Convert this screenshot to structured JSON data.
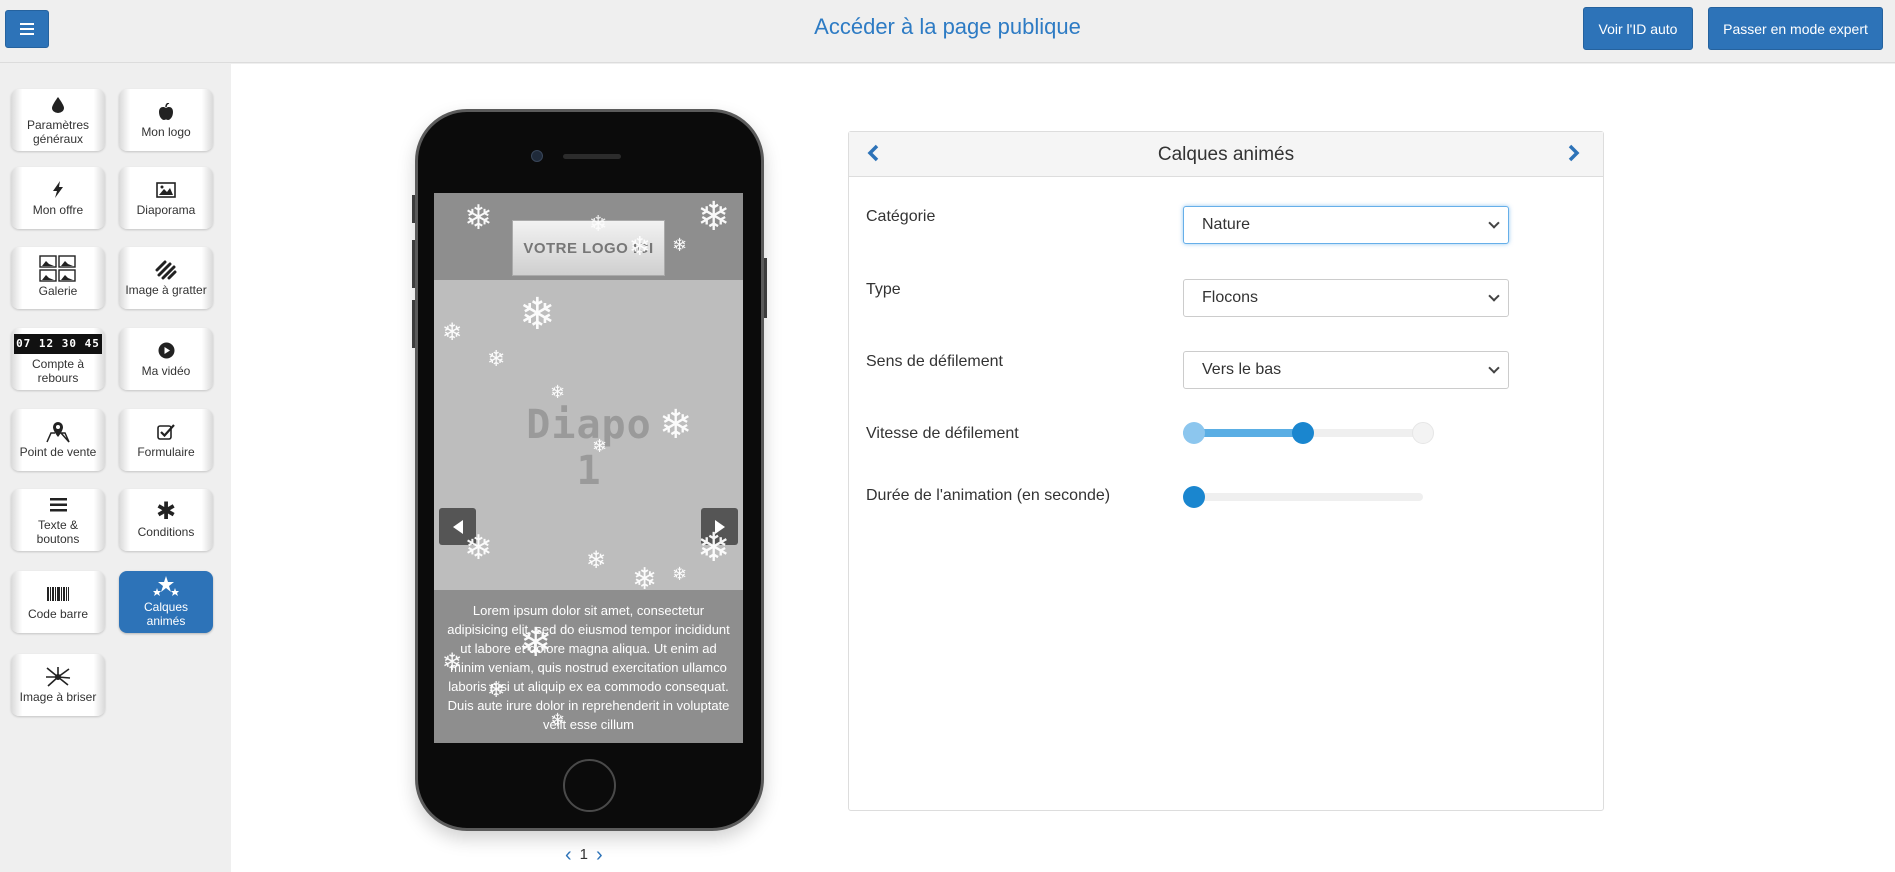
{
  "header": {
    "public_page_link": "Accéder à la page publique",
    "voir_id_button": "Voir l'ID auto",
    "expert_button": "Passer en mode expert"
  },
  "sidebar": {
    "items": [
      {
        "label": "Paramètres généraux",
        "icon": "drop-icon"
      },
      {
        "label": "Mon logo",
        "icon": "apple-icon"
      },
      {
        "label": "Mon offre",
        "icon": "bolt-icon"
      },
      {
        "label": "Diaporama",
        "icon": "image-icon"
      },
      {
        "label": "Galerie",
        "icon": "gallery-icon"
      },
      {
        "label": "Image à gratter",
        "icon": "scratch-icon"
      },
      {
        "label": "Compte à rebours",
        "icon": "countdown-icon",
        "digits": "07 12 30 45"
      },
      {
        "label": "Ma vidéo",
        "icon": "play-icon"
      },
      {
        "label": "Point de vente",
        "icon": "map-pin-icon"
      },
      {
        "label": "Formulaire",
        "icon": "checkbox-icon"
      },
      {
        "label": "Texte & boutons",
        "icon": "lines-icon"
      },
      {
        "label": "Conditions",
        "icon": "asterisk-icon"
      },
      {
        "label": "Code barre",
        "icon": "barcode-icon"
      },
      {
        "label": "Calques animés",
        "icon": "stars-icon",
        "active": true
      },
      {
        "label": "Image à briser",
        "icon": "shatter-icon"
      }
    ]
  },
  "preview": {
    "logo_text": "VOTRE LOGO ICI",
    "slide_text": "Diapo 1",
    "body_text": "Lorem ipsum dolor sit amet, consectetur adipisicing elit, sed do eiusmod tempor incididunt ut labore et dolore magna aliqua. Ut enim ad minim veniam, quis nostrud exercitation ullamco laboris nisi ut aliquip ex ea commodo consequat. Duis aute irure dolor in reprehenderit in voluptate velit esse cillum",
    "page_number": "1"
  },
  "panel": {
    "title": "Calques animés",
    "fields": {
      "categorie": {
        "label": "Catégorie",
        "value": "Nature"
      },
      "type": {
        "label": "Type",
        "value": "Flocons"
      },
      "sens": {
        "label": "Sens de défilement",
        "value": "Vers le bas"
      },
      "vitesse": {
        "label": "Vitesse de défilement",
        "range_low": 0,
        "range_high": 0.5
      },
      "duree": {
        "label": "Durée de l'animation (en seconde)",
        "value": 0
      }
    }
  },
  "colors": {
    "accent": "#2d73b8",
    "link": "#2d7bc4",
    "slider_fill": "#5aaee4",
    "slider_thumb": "#1a86cf"
  }
}
